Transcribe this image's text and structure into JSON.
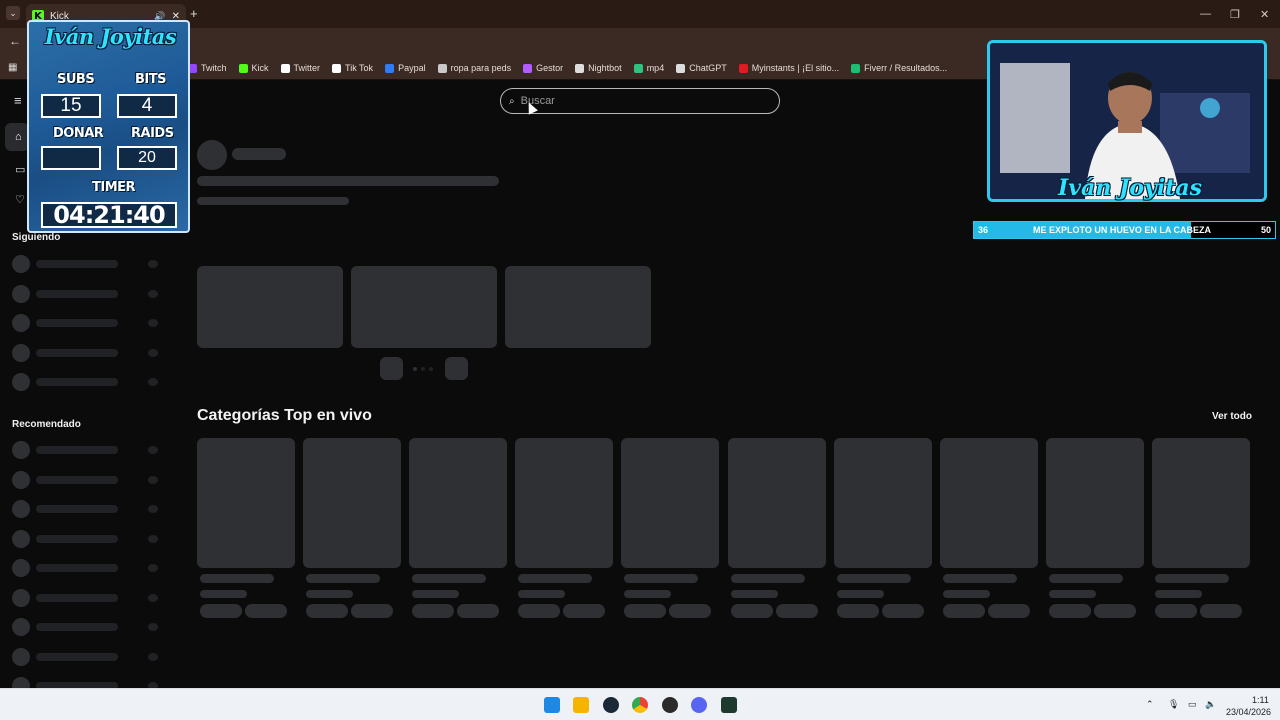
{
  "browser": {
    "tab_title": "Kick",
    "new_tab_glyph": "+",
    "bookmarks": [
      {
        "label": "Twitch",
        "icon": "twitch-icon",
        "color": "#9146ff"
      },
      {
        "label": "Kick",
        "icon": "kick-icon",
        "color": "#53fc18"
      },
      {
        "label": "Twitter",
        "icon": "x-icon",
        "color": "#ffffff"
      },
      {
        "label": "Tik Tok",
        "icon": "tiktok-icon",
        "color": "#ffffff"
      },
      {
        "label": "Paypal",
        "icon": "paypal-icon",
        "color": "#2f7cf6"
      },
      {
        "label": "ropa para peds",
        "icon": "folder-icon",
        "color": "#c9c9c9"
      },
      {
        "label": "Gestor",
        "icon": "gestor-icon",
        "color": "#b25cff"
      },
      {
        "label": "Nightbot",
        "icon": "nightbot-icon",
        "color": "#dddddd"
      },
      {
        "label": "mp4",
        "icon": "mp4-icon",
        "color": "#2ec27e"
      },
      {
        "label": "ChatGPT",
        "icon": "chatgpt-icon",
        "color": "#dddddd"
      },
      {
        "label": "Myinstants | ¡El sitio...",
        "icon": "myinstants-icon",
        "color": "#e01b24"
      },
      {
        "label": "Fiverr / Resultados...",
        "icon": "fiverr-icon",
        "color": "#1dbf73"
      }
    ]
  },
  "kick": {
    "search_placeholder": "Buscar",
    "siguiendo_label": "Siguiendo",
    "recomendado_label": "Recomendado",
    "categories_title": "Categorías Top en vivo",
    "ver_todo": "Ver todo"
  },
  "overlay": {
    "title": "Iván Joyitas",
    "subs_label": "SUBS",
    "subs_value": "15",
    "bits_label": "BITS",
    "bits_value": "4",
    "donar_label": "DONAR",
    "donar_value": "",
    "raids_label": "RAIDS",
    "raids_value": "20",
    "timer_label": "TIMER",
    "timer_value": "04:21:40"
  },
  "webcam": {
    "title": "Iván Joyitas",
    "accent": "#2ec9f0"
  },
  "prediction": {
    "left_value": "36",
    "text": "ME EXPLOTO UN HUEVO EN LA CABEZA",
    "right_value": "50",
    "fill_fraction": 0.72
  },
  "taskbar": {
    "time": "1:11",
    "date": "23/04/2026",
    "apps": [
      "windows-start-icon",
      "file-explorer-icon",
      "steam-icon",
      "chrome-icon",
      "obs-icon",
      "discord-icon",
      "terminal-icon"
    ]
  }
}
